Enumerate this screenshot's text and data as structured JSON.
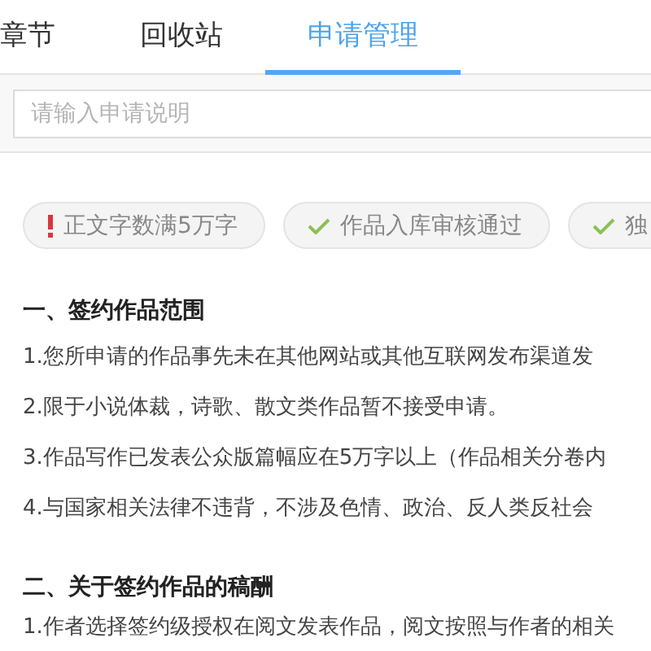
{
  "tabs": [
    {
      "label": "章节",
      "selected": false
    },
    {
      "label": "回收站",
      "selected": false
    },
    {
      "label": "申请管理",
      "selected": true
    }
  ],
  "search": {
    "placeholder": "请输入申请说明"
  },
  "requirements": [
    {
      "kind": "warning",
      "label": "正文字数满5万字"
    },
    {
      "kind": "passed",
      "label": "作品入库审核通过"
    },
    {
      "kind": "passed",
      "label": "独"
    }
  ],
  "sections": [
    {
      "heading": "一、签约作品范围",
      "lines": [
        "1.您所申请的作品事先未在其他网站或其他互联网发布渠道发",
        "2.限于小说体裁，诗歌、散文类作品暂不接受申请。",
        "3.作品写作已发表公众版篇幅应在5万字以上（作品相关分卷内",
        "4.与国家相关法律不违背，不涉及色情、政治、反人类反社会"
      ]
    },
    {
      "heading": "二、关于签约作品的稿酬",
      "lines": [
        "1.作者选择签约级授权在阅文发表作品，阅文按照与作者的相关"
      ]
    }
  ]
}
